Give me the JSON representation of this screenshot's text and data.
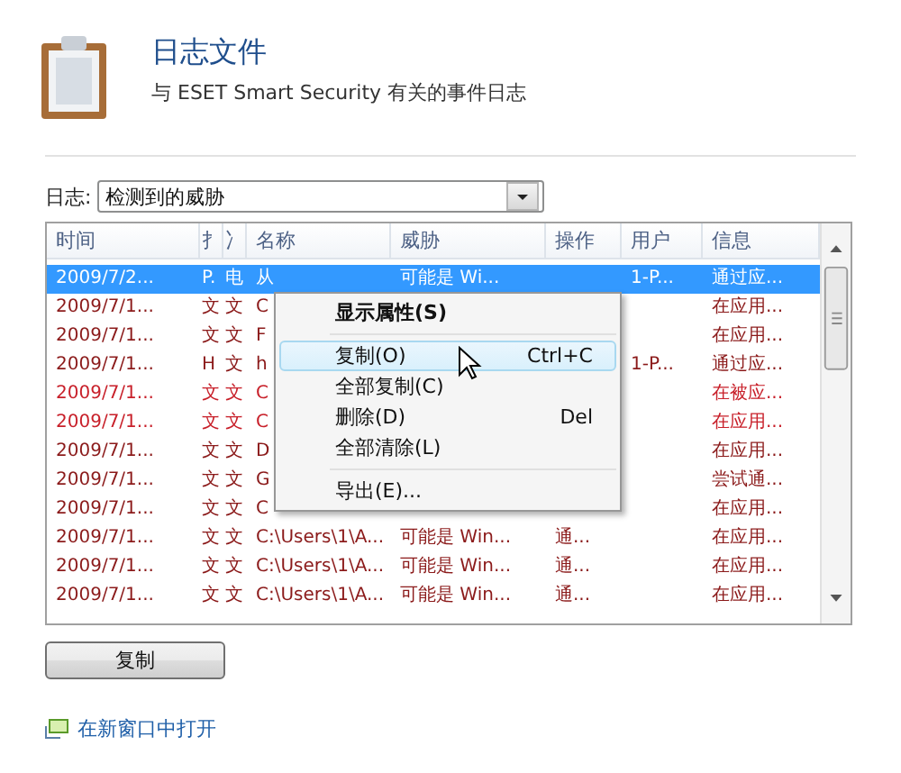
{
  "header": {
    "title": "日志文件",
    "subtitle": "与 ESET Smart Security 有关的事件日志"
  },
  "log_select": {
    "label": "日志:",
    "value": "检测到的威胁"
  },
  "table": {
    "columns": [
      "时间",
      "扌",
      "冫",
      "名称",
      "威胁",
      "操作",
      "用户",
      "信息"
    ],
    "rows": [
      {
        "selected": true,
        "time": "2009/7/2...",
        "column_2": "P.",
        "column_3": "电",
        "name": "从",
        "threat": "可能是 Wi...",
        "user": "1-P...",
        "info": "通过应..."
      },
      {
        "selected": false,
        "color": "#8b1a1a",
        "time": "2009/7/1...",
        "column_2": "文",
        "column_3": "文",
        "name": "C",
        "info": "在应用..."
      },
      {
        "selected": false,
        "color": "#8b1a1a",
        "time": "2009/7/1...",
        "column_2": "文",
        "column_3": "文",
        "name": "F",
        "info": "在应用..."
      },
      {
        "selected": false,
        "color": "#8b1a1a",
        "time": "2009/7/1...",
        "column_2": "H",
        "column_3": "文",
        "name": "h",
        "user": "1-P...",
        "info": "通过应..."
      },
      {
        "selected": false,
        "color": "#c8202a",
        "time": "2009/7/1...",
        "column_2": "文",
        "column_3": "文",
        "name": "C",
        "info": "在被应..."
      },
      {
        "selected": false,
        "color": "#c8202a",
        "time": "2009/7/1...",
        "column_2": "文",
        "column_3": "文",
        "name": "C",
        "info": "在应用..."
      },
      {
        "selected": false,
        "color": "#8b1a1a",
        "time": "2009/7/1...",
        "column_2": "文",
        "column_3": "文",
        "name": "D",
        "info": "在应用..."
      },
      {
        "selected": false,
        "color": "#8b1a1a",
        "time": "2009/7/1...",
        "column_2": "文",
        "column_3": "文",
        "name": "G",
        "info": "尝试通..."
      },
      {
        "selected": false,
        "color": "#8b1a1a",
        "time": "2009/7/1...",
        "column_2": "文",
        "column_3": "文",
        "name": "C",
        "info": "在应用..."
      },
      {
        "selected": false,
        "color": "#8b1a1a",
        "time": "2009/7/1...",
        "column_2": "文",
        "column_3": "文",
        "name": "C:\\Users\\1\\A...",
        "threat": "可能是 Win...",
        "action": "通...",
        "info": "在应用..."
      },
      {
        "selected": false,
        "color": "#8b1a1a",
        "time": "2009/7/1...",
        "column_2": "文",
        "column_3": "文",
        "name": "C:\\Users\\1\\A...",
        "threat": "可能是 Win...",
        "action": "通...",
        "info": "在应用..."
      },
      {
        "selected": false,
        "color": "#8b1a1a",
        "time": "2009/7/1...",
        "column_2": "文",
        "column_3": "文",
        "name": "C:\\Users\\1\\A...",
        "threat": "可能是 Win...",
        "action": "通...",
        "info": "在应用..."
      }
    ]
  },
  "context_menu": [
    {
      "label": "显示属性(S)",
      "default": true,
      "separator_after": true,
      "selected": false
    },
    {
      "label": "复制(O)",
      "shortcut": "Ctrl+C",
      "selected": true
    },
    {
      "label": "全部复制(C)",
      "selected": false
    },
    {
      "label": "删除(D)",
      "shortcut": "Del",
      "selected": false
    },
    {
      "label": "全部清除(L)",
      "separator_after": true,
      "selected": false
    },
    {
      "label": "导出(E)...",
      "selected": false
    }
  ],
  "copy_button": "复制",
  "open_link": "在新窗口中打开"
}
